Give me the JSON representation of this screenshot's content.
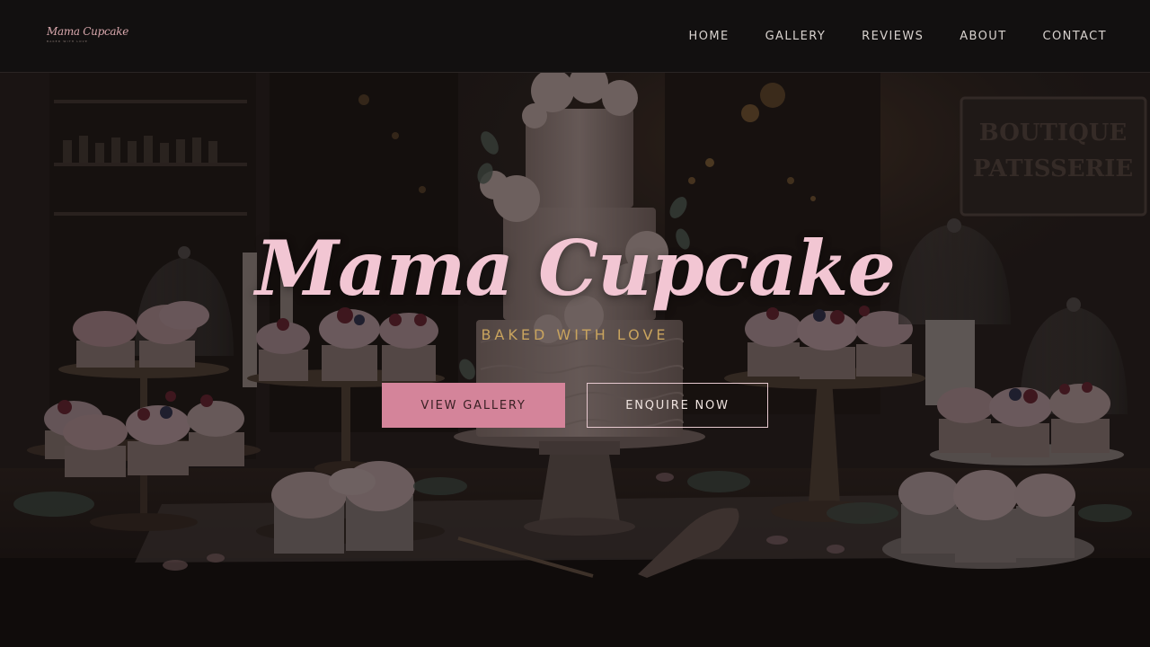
{
  "header": {
    "logo": {
      "name": "Mama Cupcake",
      "tagline": "baked with love"
    },
    "nav": [
      {
        "label": "HOME"
      },
      {
        "label": "GALLERY"
      },
      {
        "label": "REVIEWS"
      },
      {
        "label": "ABOUT"
      },
      {
        "label": "CONTACT"
      }
    ]
  },
  "hero": {
    "title": "Mama Cupcake",
    "subtitle": "BAKED WITH LOVE",
    "buttons": {
      "primary_label": "VIEW GALLERY",
      "secondary_label": "ENQUIRE NOW"
    },
    "background_sign": "BOUTIQUE PATISSERIE"
  },
  "colors": {
    "navbar_bg": "#121010",
    "nav_text": "#d8d2ce",
    "title_pink": "#f2c6d3",
    "subtitle_gold": "#c9a45e",
    "primary_button": "#d4849a",
    "outline_border": "#e6c9cf"
  }
}
